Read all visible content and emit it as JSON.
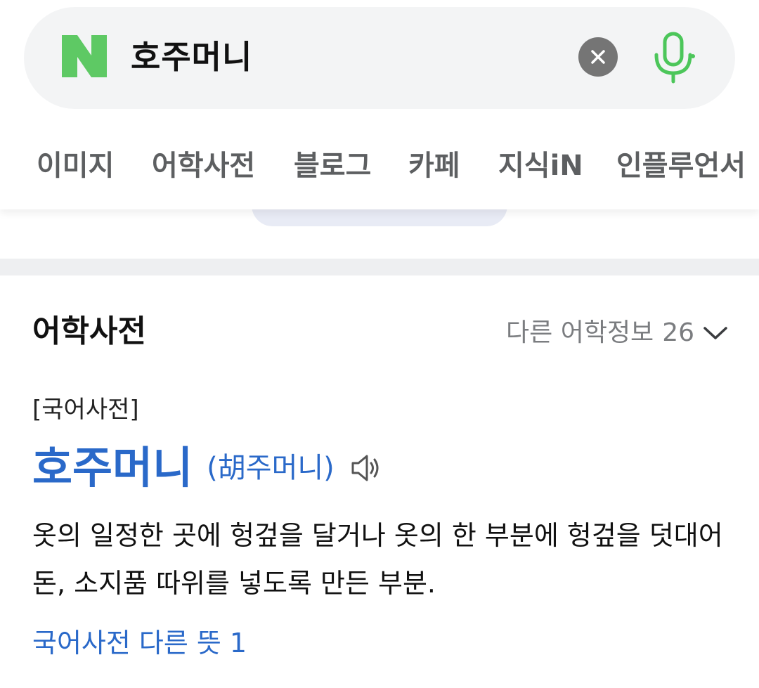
{
  "search": {
    "query": "호주머니"
  },
  "colors": {
    "brand_green": "#03c75a",
    "link_blue": "#2a69c9",
    "muted_gray": "#7b7d80"
  },
  "icons": {
    "logo": "naver-n-logo",
    "clear": "close-icon",
    "mic": "microphone-icon",
    "speaker": "speaker-icon",
    "chevron": "chevron-down-icon"
  },
  "tabs": [
    {
      "label": "이미지"
    },
    {
      "label": "어학사전"
    },
    {
      "label": "블로그"
    },
    {
      "label": "카페"
    },
    {
      "label": "지식iN"
    },
    {
      "label": "인플루언서"
    }
  ],
  "section": {
    "title": "어학사전",
    "more_label": "다른 어학정보",
    "more_count": "26"
  },
  "entry": {
    "source": "[국어사전]",
    "headword": "호주머니",
    "hanja": "(胡주머니)",
    "definition": "옷의 일정한 곳에 헝겊을 달거나 옷의 한 부분에 헝겊을 덧대어 돈, 소지품 따위를 넣도록 만든 부분.",
    "other_meanings_label": "국어사전 다른 뜻",
    "other_meanings_count": "1"
  }
}
